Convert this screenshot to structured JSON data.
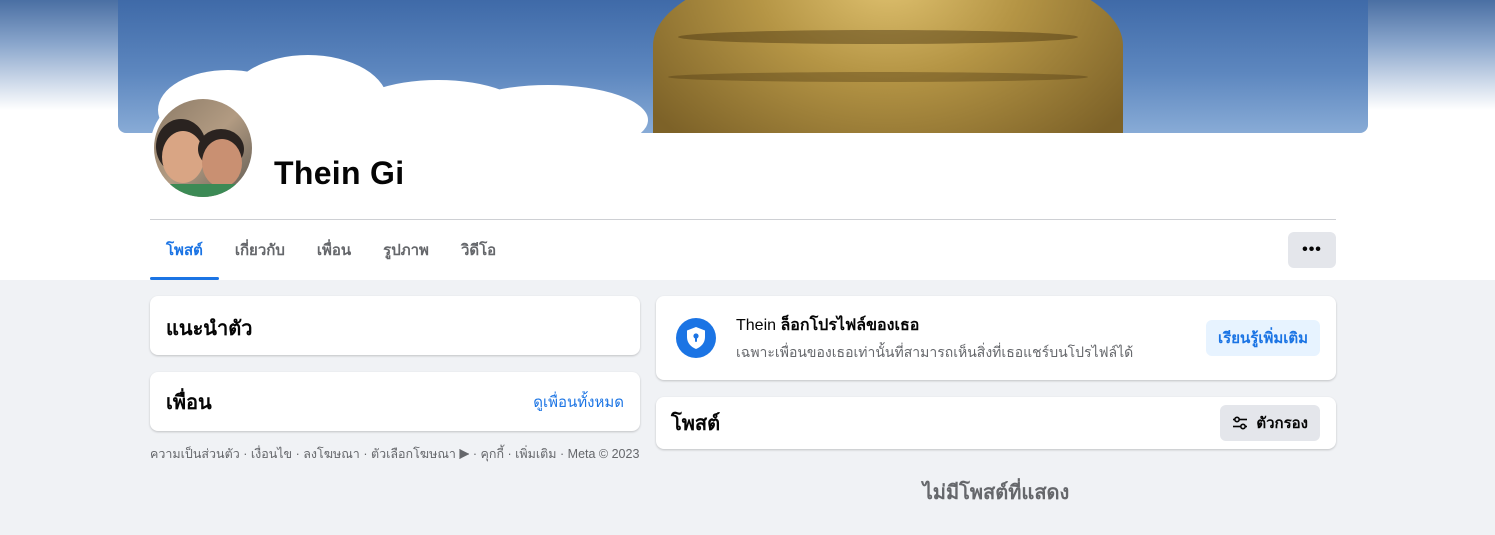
{
  "profile": {
    "name": "Thein Gi"
  },
  "tabs": [
    {
      "label": "โพสต์",
      "active": true
    },
    {
      "label": "เกี่ยวกับ",
      "active": false
    },
    {
      "label": "เพื่อน",
      "active": false
    },
    {
      "label": "รูปภาพ",
      "active": false
    },
    {
      "label": "วิดีโอ",
      "active": false
    }
  ],
  "more_button": {
    "label": "•••"
  },
  "intro": {
    "title": "แนะนำตัว"
  },
  "friends": {
    "title": "เพื่อน",
    "see_all": "ดูเพื่อนทั้งหมด"
  },
  "footer": {
    "links": [
      "ความเป็นส่วนตัว",
      "เงื่อนไข",
      "ลงโฆษณา",
      "ตัวเลือกโฆษณา",
      "คุกกี้",
      "เพิ่มเติม"
    ],
    "copyright": "Meta © 2023"
  },
  "locked_notice": {
    "name": "Thein",
    "title_rest": "ล็อกโปรไฟล์ของเธอ",
    "subtitle": "เฉพาะเพื่อนของเธอเท่านั้นที่สามารถเห็นสิ่งที่เธอแชร์บนโปรไฟล์ได้",
    "learn_more": "เรียนรู้เพิ่มเติม",
    "icon": "shield-lock-icon"
  },
  "posts": {
    "title": "โพสต์",
    "filter_label": "ตัวกรอง",
    "empty_message": "ไม่มีโพสต์ที่แสดง"
  },
  "colors": {
    "accent": "#1b74e4",
    "background": "#f0f2f5",
    "secondary_text": "#65676b"
  }
}
